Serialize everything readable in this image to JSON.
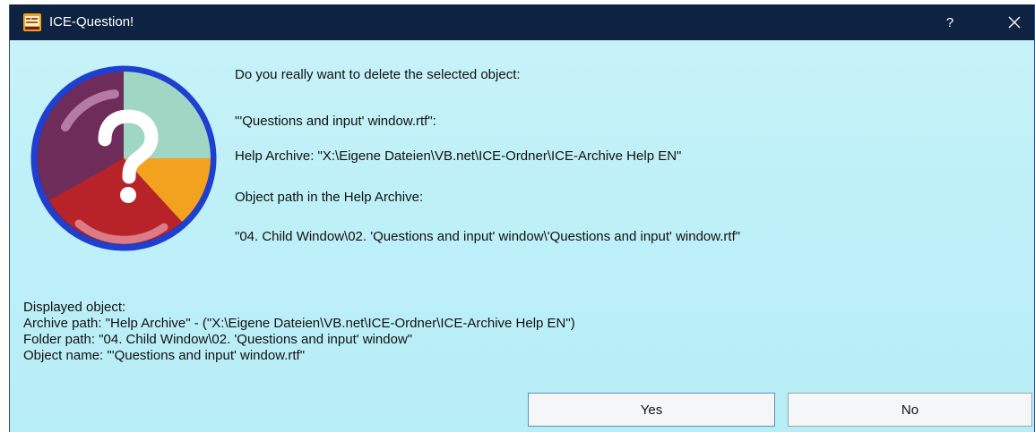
{
  "window": {
    "title": "ICE-Question!",
    "help_label": "?",
    "icons": {
      "app": "ice-app-icon",
      "close": "close-icon",
      "question": "question-mark-pie-icon"
    }
  },
  "message": {
    "line1": "Do you really want to delete the selected object:",
    "line2": "\"'Questions and input' window.rtf\":",
    "line3": "Help Archive: \"X:\\Eigene Dateien\\VB.net\\ICE-Ordner\\ICE-Archive Help EN\"",
    "line4": "Object path in the Help Archive:",
    "line5": "\"04. Child Window\\02. 'Questions and input' window\\'Questions and input' window.rtf\""
  },
  "details": {
    "heading": "Displayed object:",
    "archive_path": "Archive path: \"Help Archive\" - (\"X:\\Eigene Dateien\\VB.net\\ICE-Ordner\\ICE-Archive Help EN\")",
    "folder_path": "Folder path: \"04. Child Window\\02. 'Questions and input' window\"",
    "object_name": "Object name: \"'Questions and input' window.rtf\""
  },
  "buttons": {
    "yes": "Yes",
    "no": "No"
  },
  "colors": {
    "titlebar": "#0e2341",
    "background": "#c3f1f8",
    "ring": "#1f3fd0"
  }
}
